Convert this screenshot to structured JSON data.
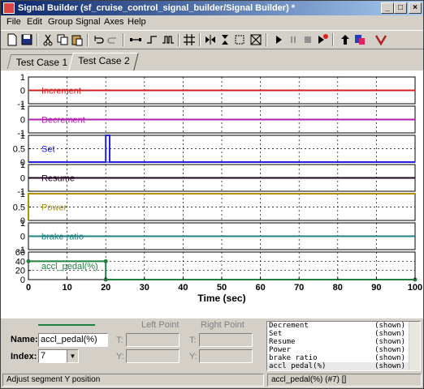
{
  "window": {
    "title": "Signal Builder (sf_cruise_control_signal_builder/Signal Builder) *"
  },
  "menu": [
    "File",
    "Edit",
    "Group",
    "Signal",
    "Axes",
    "Help"
  ],
  "tabs": [
    {
      "label": "Test Case 1",
      "active": false
    },
    {
      "label": "Test Case 2",
      "active": true
    }
  ],
  "chart_data": {
    "type": "line",
    "xlabel": "Time (sec)",
    "xlim": [
      0,
      100
    ],
    "xticks": [
      "0",
      "10",
      "20",
      "30",
      "40",
      "50",
      "60",
      "70",
      "80",
      "90",
      "100"
    ],
    "series": [
      {
        "name": "Increment",
        "color": "#d02020",
        "ylim": [
          -1,
          1
        ],
        "yticks": [
          "1",
          "0",
          "-1"
        ],
        "x": [
          0,
          100
        ],
        "y": [
          0,
          0
        ]
      },
      {
        "name": "Decrement",
        "color": "#b020b0",
        "ylim": [
          -1,
          1
        ],
        "yticks": [
          "1",
          "0",
          "-1"
        ],
        "x": [
          0,
          100
        ],
        "y": [
          0,
          0
        ]
      },
      {
        "name": "Set",
        "color": "#2020e0",
        "ylim": [
          0,
          1
        ],
        "yticks": [
          "1",
          "0.5",
          "0"
        ],
        "x": [
          0,
          20,
          20,
          21,
          21,
          100
        ],
        "y": [
          0,
          0,
          1,
          1,
          0,
          0
        ]
      },
      {
        "name": "Resume",
        "color": "#200020",
        "ylim": [
          -1,
          1
        ],
        "yticks": [
          "1",
          "0",
          "-1"
        ],
        "x": [
          0,
          100
        ],
        "y": [
          0,
          0
        ]
      },
      {
        "name": "Power",
        "color": "#b09000",
        "ylim": [
          0,
          1
        ],
        "yticks": [
          "1",
          "0.5",
          "0"
        ],
        "x": [
          0,
          0,
          100
        ],
        "y": [
          0,
          1,
          1
        ]
      },
      {
        "name": "brake ratio",
        "color": "#208080",
        "ylim": [
          -1,
          1
        ],
        "yticks": [
          "1",
          "0",
          "-1"
        ],
        "x": [
          0,
          100
        ],
        "y": [
          0,
          0
        ]
      },
      {
        "name": "accl_pedal(%)",
        "color": "#208040",
        "ylim": [
          0,
          60
        ],
        "yticks": [
          "60",
          "40",
          "20",
          "0"
        ],
        "x": [
          0,
          20,
          20,
          100
        ],
        "y": [
          40,
          40,
          0,
          0
        ]
      }
    ]
  },
  "editor": {
    "left_point_label": "Left Point",
    "right_point_label": "Right Point",
    "name_label": "Name:",
    "name_value": "accl_pedal(%)",
    "index_label": "Index:",
    "index_value": "7",
    "t_label": "T:",
    "y_label": "Y:",
    "line_color": "#208040"
  },
  "signal_list": [
    {
      "name": "Decrement",
      "status": "(shown)"
    },
    {
      "name": "Set",
      "status": "(shown)"
    },
    {
      "name": "Resume",
      "status": "(shown)"
    },
    {
      "name": "Power",
      "status": "(shown)"
    },
    {
      "name": "brake ratio",
      "status": "(shown)"
    },
    {
      "name": "accl pedal(%)",
      "status": "(shown)"
    }
  ],
  "status": {
    "hint": "Adjust segment Y position",
    "selection": "accl_pedal(%) (#7) []"
  },
  "toolbar": [
    "new-icon",
    "save-icon",
    "cut-icon",
    "copy-icon",
    "paste-icon",
    "undo-icon",
    "redo-icon",
    "segment-icon",
    "step-icon",
    "pulse-icon",
    "triangle-pulse-icon",
    "grid-icon",
    "flip-horizontal-icon",
    "flip-vertical-icon",
    "fit-icon",
    "zoom-fit-icon",
    "play-icon",
    "pause-icon",
    "stop-icon",
    "record-icon",
    "step-up-icon",
    "export-icon",
    "verify-icon"
  ]
}
